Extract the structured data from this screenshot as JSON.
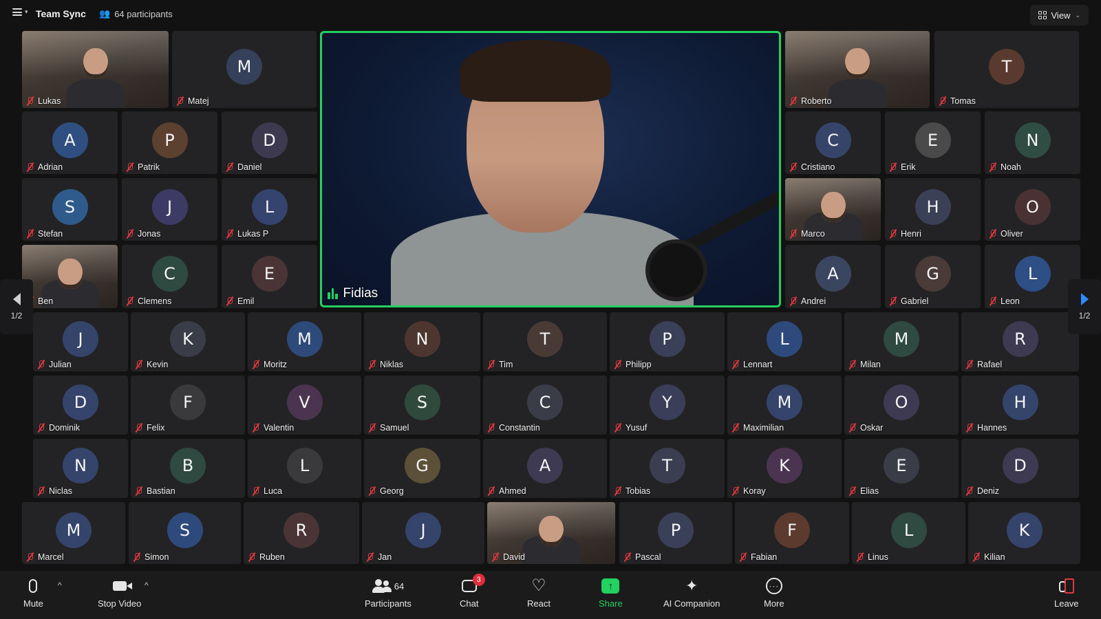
{
  "topbar": {
    "title": "Team Sync",
    "participants_label": "64 participants",
    "view_label": "View"
  },
  "speaker": {
    "name": "Fidias",
    "audio_level": 0.8
  },
  "pagination": {
    "left": "1/2",
    "right": "1/2"
  },
  "colors": {
    "accent": "#23d160",
    "muted": "#e0383e",
    "nav_arrow": "#2d8cff",
    "badge": "#e02d3c"
  },
  "tiles": [
    {
      "name": "Lukas",
      "video": true
    },
    {
      "name": "Matej",
      "initial": "M",
      "color": "#35405a"
    },
    {
      "name": "Roberto",
      "video": true
    },
    {
      "name": "Tomas",
      "initial": "T",
      "color": "#5a3a2e"
    },
    {
      "name": "Adrian",
      "initial": "A",
      "color": "#2f4f80"
    },
    {
      "name": "Patrik",
      "initial": "P",
      "color": "#5c4030"
    },
    {
      "name": "Daniel",
      "initial": "D",
      "color": "#3d3a50"
    },
    {
      "name": "Cristiano",
      "initial": "C",
      "color": "#36446a"
    },
    {
      "name": "Erik",
      "initial": "E",
      "color": "#4a4a4a"
    },
    {
      "name": "Noah",
      "initial": "N",
      "color": "#2f4d42"
    },
    {
      "name": "Stefan",
      "initial": "S",
      "color": "#2f5b8c"
    },
    {
      "name": "Jonas",
      "initial": "J",
      "color": "#3e3a66"
    },
    {
      "name": "Lukas P",
      "initial": "L",
      "color": "#34446e"
    },
    {
      "name": "Marco",
      "video": true
    },
    {
      "name": "Henri",
      "initial": "H",
      "color": "#3a4055"
    },
    {
      "name": "Oliver",
      "initial": "O",
      "color": "#4a3234"
    },
    {
      "name": "Ben",
      "video": true
    },
    {
      "name": "Clemens",
      "initial": "C",
      "color": "#2f4a40"
    },
    {
      "name": "Emil",
      "initial": "E",
      "color": "#4a3436"
    },
    {
      "name": "Andrei",
      "initial": "A",
      "color": "#3a4660"
    },
    {
      "name": "Gabriel",
      "initial": "G",
      "color": "#4a3a38"
    },
    {
      "name": "Leon",
      "initial": "L",
      "color": "#2e4e86"
    },
    {
      "name": "Julian",
      "initial": "J",
      "color": "#34446a"
    },
    {
      "name": "Kevin",
      "initial": "K",
      "color": "#3a3c48"
    },
    {
      "name": "Moritz",
      "initial": "M",
      "color": "#2e4a7a"
    },
    {
      "name": "Niklas",
      "initial": "N",
      "color": "#4e3630"
    },
    {
      "name": "Tim",
      "initial": "T",
      "color": "#4a3a36"
    },
    {
      "name": "Philipp",
      "initial": "P",
      "color": "#3a4058"
    },
    {
      "name": "Lennart",
      "initial": "L",
      "color": "#2e4a7c"
    },
    {
      "name": "Milan",
      "initial": "M",
      "color": "#2f4a40"
    },
    {
      "name": "Rafael",
      "initial": "R",
      "color": "#3e3a52"
    },
    {
      "name": "Dominik",
      "initial": "D",
      "color": "#34446a"
    },
    {
      "name": "Felix",
      "initial": "F",
      "color": "#3a3a3c"
    },
    {
      "name": "Valentin",
      "initial": "V",
      "color": "#4a3450"
    },
    {
      "name": "Samuel",
      "initial": "S",
      "color": "#2f4a3c"
    },
    {
      "name": "Constantin",
      "initial": "C",
      "color": "#3a3c48"
    },
    {
      "name": "Yusuf",
      "initial": "Y",
      "color": "#3a3e58"
    },
    {
      "name": "Maximilian",
      "initial": "M",
      "color": "#34446a"
    },
    {
      "name": "Oskar",
      "initial": "O",
      "color": "#3e3a52"
    },
    {
      "name": "Hannes",
      "initial": "H",
      "color": "#34446a"
    },
    {
      "name": "Niclas",
      "initial": "N",
      "color": "#34446a"
    },
    {
      "name": "Bastian",
      "initial": "B",
      "color": "#2f4a40"
    },
    {
      "name": "Luca",
      "initial": "L",
      "color": "#3a3a3c"
    },
    {
      "name": "Georg",
      "initial": "G",
      "color": "#5c5038"
    },
    {
      "name": "Ahmed",
      "initial": "A",
      "color": "#3e3a52"
    },
    {
      "name": "Tobias",
      "initial": "T",
      "color": "#3a3e50"
    },
    {
      "name": "Koray",
      "initial": "K",
      "color": "#4a3450"
    },
    {
      "name": "Elias",
      "initial": "E",
      "color": "#3a3c48"
    },
    {
      "name": "Deniz",
      "initial": "D",
      "color": "#3e3a52"
    },
    {
      "name": "Marcel",
      "initial": "M",
      "color": "#34446a"
    },
    {
      "name": "Simon",
      "initial": "S",
      "color": "#2e4a7c"
    },
    {
      "name": "Ruben",
      "initial": "R",
      "color": "#4a3436"
    },
    {
      "name": "Jan",
      "initial": "J",
      "color": "#34446a"
    },
    {
      "name": "David",
      "video": true
    },
    {
      "name": "Pascal",
      "initial": "P",
      "color": "#3a4058"
    },
    {
      "name": "Fabian",
      "initial": "F",
      "color": "#5c3a2e"
    },
    {
      "name": "Linus",
      "initial": "L",
      "color": "#2f4a40"
    },
    {
      "name": "Kilian",
      "initial": "K",
      "color": "#34446a"
    }
  ],
  "toolbar": {
    "mute": "Mute",
    "stop_video": "Stop Video",
    "participants": "Participants",
    "participants_count": "64",
    "chat": "Chat",
    "chat_badge": "3",
    "react": "React",
    "share": "Share",
    "ai_companion": "AI Companion",
    "more": "More",
    "leave": "Leave"
  }
}
